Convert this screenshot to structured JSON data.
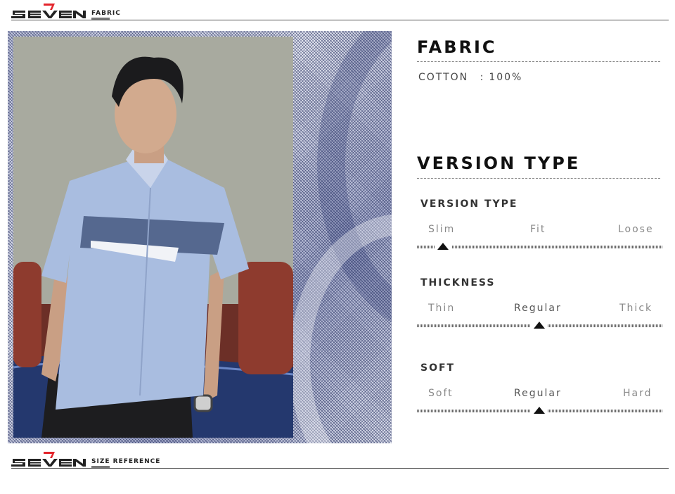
{
  "header_top": {
    "brand": "SEVEN",
    "tag": "FABRIC"
  },
  "fabric": {
    "title": "FABRIC",
    "material": "COTTON",
    "separator": ":",
    "percent": "100%"
  },
  "version": {
    "title": "VERSION TYPE",
    "rows": [
      {
        "title": "VERSION TYPE",
        "labels": [
          "Slim",
          "Fit",
          "Loose"
        ],
        "selected": 0
      },
      {
        "title": "THICKNESS",
        "labels": [
          "Thin",
          "Regular",
          "Thick"
        ],
        "selected": 1
      },
      {
        "title": "SOFT",
        "labels": [
          "Soft",
          "Regular",
          "Hard"
        ],
        "selected": 1
      }
    ]
  },
  "header_bottom": {
    "brand": "SEVEN",
    "tag": "SIZE REFERENCE"
  },
  "colors": {
    "accent": "#e3242b",
    "text": "#222222",
    "shirt": "#a9bde0",
    "fabric": "#3b4a8a"
  }
}
